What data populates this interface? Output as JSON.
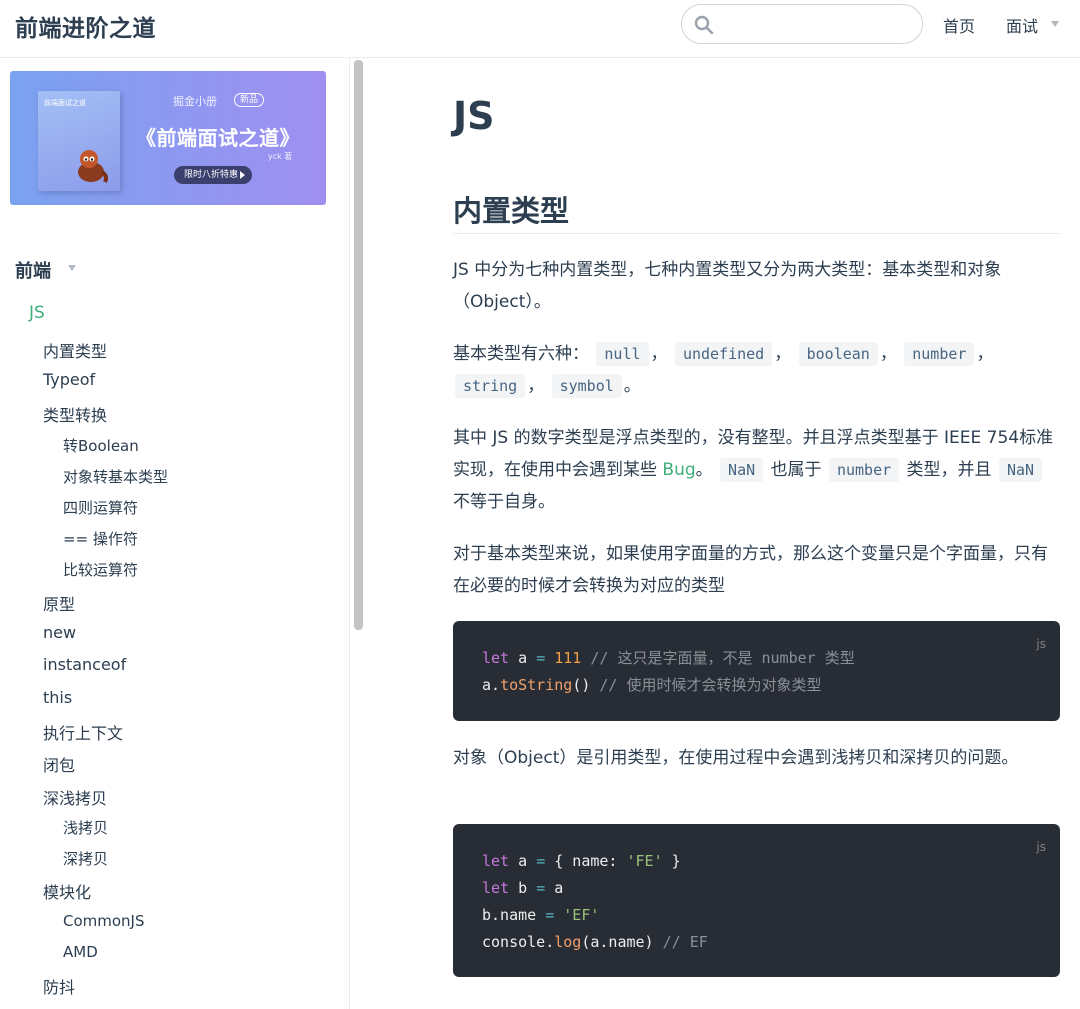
{
  "header": {
    "site_name": "前端进阶之道",
    "search": {
      "value": "",
      "placeholder": ""
    },
    "nav": {
      "home": "首页",
      "interview": "面试"
    }
  },
  "banner": {
    "book_title": "前端面试之道",
    "brand": "掘金小册",
    "badge": "新品",
    "title": "《前端面试之道》",
    "author": "yck 著",
    "cta": "限时八折特惠"
  },
  "sidebar": {
    "group_title": "前端",
    "items": [
      {
        "label": "JS",
        "level": 0,
        "active": true
      },
      {
        "label": "内置类型",
        "level": 1
      },
      {
        "label": "Typeof",
        "level": 1
      },
      {
        "label": "类型转换",
        "level": 1
      },
      {
        "label": "转Boolean",
        "level": 2
      },
      {
        "label": "对象转基本类型",
        "level": 2
      },
      {
        "label": "四则运算符",
        "level": 2
      },
      {
        "label": "== 操作符",
        "level": 2
      },
      {
        "label": "比较运算符",
        "level": 2
      },
      {
        "label": "原型",
        "level": 1
      },
      {
        "label": "new",
        "level": 1
      },
      {
        "label": "instanceof",
        "level": 1
      },
      {
        "label": "this",
        "level": 1
      },
      {
        "label": "执行上下文",
        "level": 1
      },
      {
        "label": "闭包",
        "level": 1
      },
      {
        "label": "深浅拷贝",
        "level": 1
      },
      {
        "label": "浅拷贝",
        "level": 2
      },
      {
        "label": "深拷贝",
        "level": 2
      },
      {
        "label": "模块化",
        "level": 1
      },
      {
        "label": "CommonJS",
        "level": 2
      },
      {
        "label": "AMD",
        "level": 2
      },
      {
        "label": "防抖",
        "level": 1
      }
    ]
  },
  "content": {
    "h1": "JS",
    "h2": "内置类型",
    "p1": "JS 中分为七种内置类型，七种内置类型又分为两大类型：基本类型和对象（Object）。",
    "p2_prefix": "基本类型有六种：",
    "p2_codes": [
      "null",
      "undefined",
      "boolean",
      "number",
      "string",
      "symbol"
    ],
    "p2_sep": "，",
    "p2_end": "。",
    "p3": {
      "a": "其中 JS 的数字类型是浮点类型的，没有整型。并且浮点类型基于 IEEE 754标准实现，在使用中会遇到某些 ",
      "link": "Bug",
      "b": "。",
      "code1": "NaN",
      "c": " 也属于 ",
      "code2": "number",
      "d": " 类型，并且 ",
      "code3": "NaN",
      "e": " 不等于自身。"
    },
    "p4": "对于基本类型来说，如果使用字面量的方式，那么这个变量只是个字面量，只有在必要的时候才会转换为对应的类型",
    "code1": {
      "lang": "js",
      "l1_kw": "let",
      "l1_var": " a ",
      "l1_op": "=",
      "l1_num": " 111",
      "l1_cm": " // 这只是字面量，不是 number 类型",
      "l2_obj": "a.",
      "l2_fn": "toString",
      "l2_rest": "()",
      "l2_cm": " // 使用时候才会转换为对象类型"
    },
    "p5": "对象（Object）是引用类型，在使用过程中会遇到浅拷贝和深拷贝的问题。",
    "code2": {
      "lang": "js",
      "l1_kw": "let",
      "l1_a": " a ",
      "l1_op": "=",
      "l1_b": " { name: ",
      "l1_str": "'FE'",
      "l1_c": " }",
      "l2_kw": "let",
      "l2_a": " b ",
      "l2_op": "=",
      "l2_b": " a",
      "l3_a": "b.name ",
      "l3_op": "=",
      "l3_str": " 'EF'",
      "l4_a": "console.",
      "l4_fn": "log",
      "l4_b": "(a.name)",
      "l4_cm": " // EF"
    }
  }
}
